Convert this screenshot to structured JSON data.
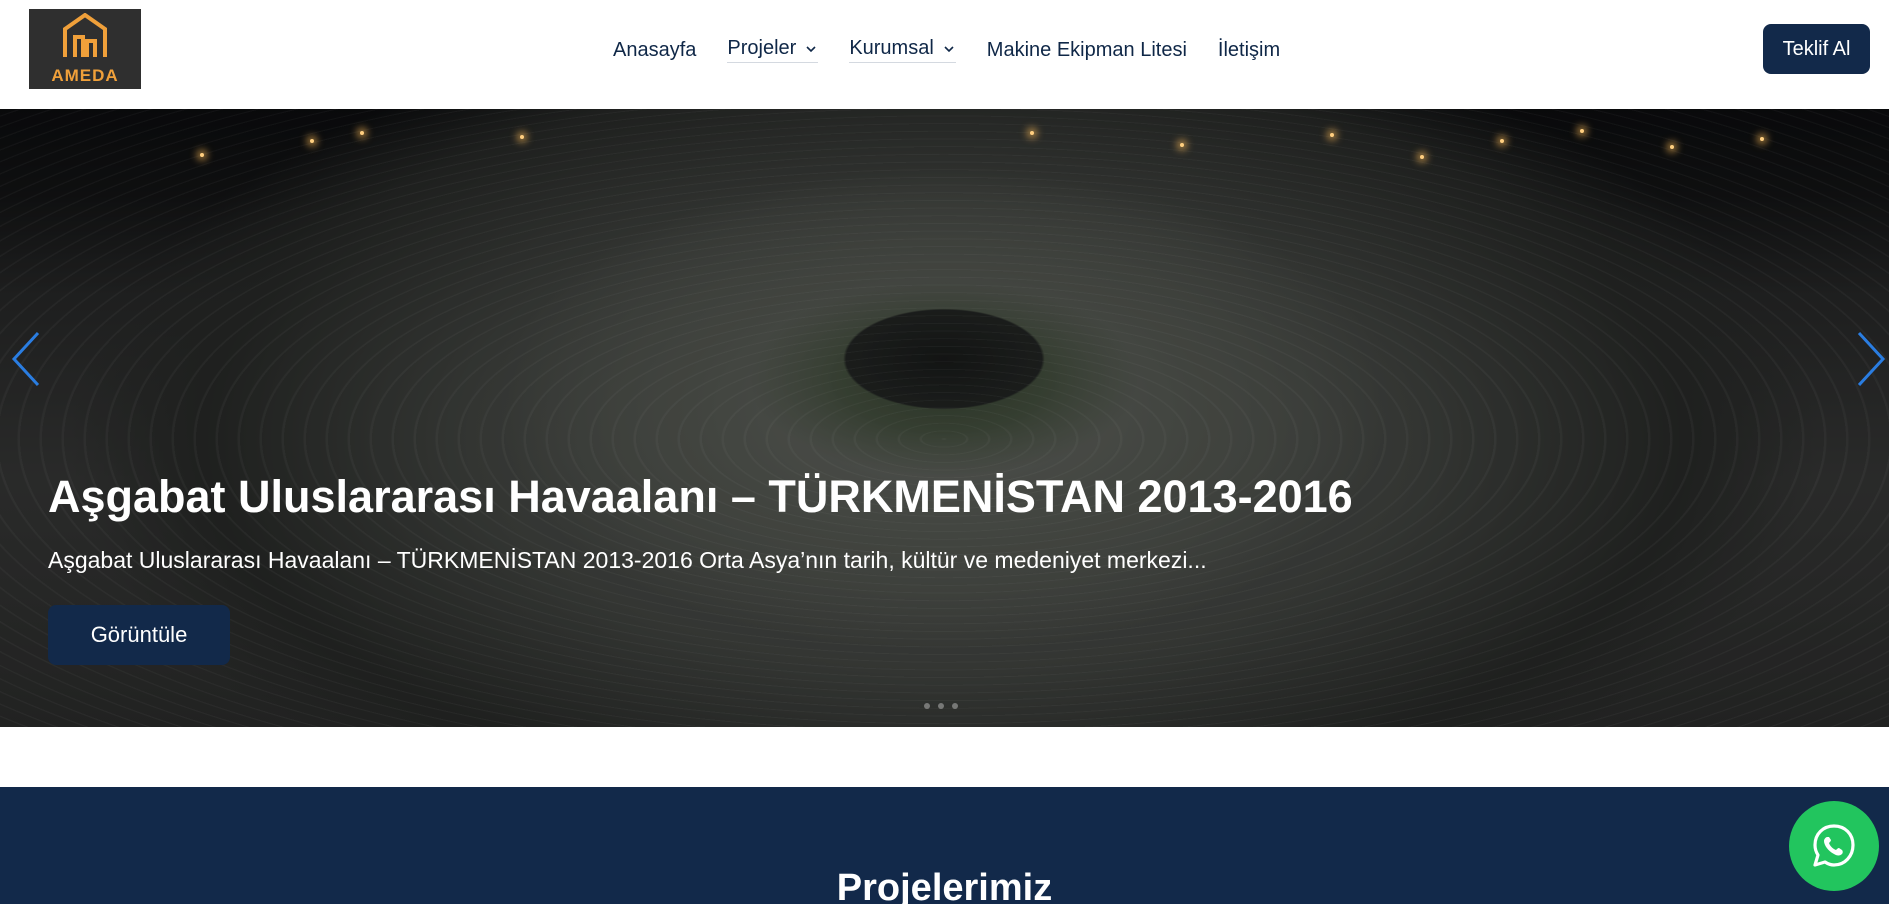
{
  "header": {
    "logo_text": "AMEDA",
    "nav": [
      {
        "label": "Anasayfa"
      },
      {
        "label": "Projeler"
      },
      {
        "label": "Kurumsal"
      },
      {
        "label": "Makine Ekipman Litesi"
      },
      {
        "label": "İletişim"
      }
    ],
    "quote_button": "Teklif Al"
  },
  "hero": {
    "title": "Aşgabat Uluslararası Havaalanı – TÜRKMENİSTAN 2013-2016",
    "description": "Aşgabat Uluslararası Havaalanı – TÜRKMENİSTAN 2013-2016 Orta Asya’nın tarih, kültür ve medeniyet merkezi...",
    "button": "Görüntüle",
    "prev_icon": "chevron-left-icon",
    "next_icon": "chevron-right-icon"
  },
  "projects": {
    "title": "Projelerimiz"
  },
  "colors": {
    "brand_navy": "#12294a",
    "logo_orange": "#f0a03a",
    "whatsapp_green": "#22c55e",
    "arrow_blue": "#2a7de1"
  }
}
